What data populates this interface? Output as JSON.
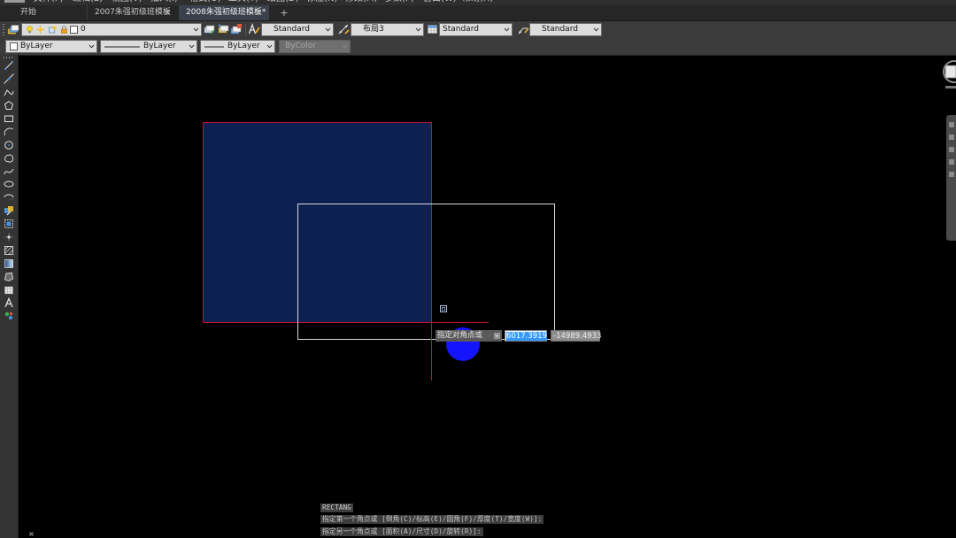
{
  "menu": [
    "文件(F)",
    "编辑(E)",
    "视图(V)",
    "插入(I)",
    "格式(O)",
    "工具(T)",
    "绘图(D)",
    "标注(N)",
    "修改(M)",
    "参数(P)",
    "窗口(W)",
    "帮助(H)"
  ],
  "tabs": {
    "start": "开始",
    "docs": [
      {
        "label": "2007朱强初级班模板",
        "close": "×",
        "active": false
      },
      {
        "label": "2008朱强初级班模板*",
        "close": "×",
        "active": true
      }
    ],
    "add": "+"
  },
  "toolbar_row1": {
    "layer": {
      "name": "0",
      "color": "#ffffff"
    },
    "text_style": "Standard",
    "dim_style": "布局3",
    "table_style": "Standard",
    "mleader_style": "Standard"
  },
  "toolbar_row2": {
    "color": "ByLayer",
    "linetype": "ByLayer",
    "lineweight": "ByLayer",
    "plot_style": "ByColor",
    "plot_style_enabled": false
  },
  "left_toolbar": {
    "tools": [
      "line-icon",
      "construction-line-icon",
      "polyline-icon",
      "polygon-icon",
      "rectangle-icon",
      "arc-icon",
      "circle-icon",
      "revision-cloud-icon",
      "spline-icon",
      "ellipse-icon",
      "ellipse-arc-icon",
      "insert-block-icon",
      "make-block-icon",
      "point-icon",
      "hatch-icon",
      "gradient-icon",
      "region-icon",
      "table-icon",
      "multiline-text-icon",
      "add-selected-icon"
    ]
  },
  "dynamic_input": {
    "prompt": "指定对角点或",
    "x_value": "6017.3919",
    "y_value": "-14989.4933"
  },
  "command_line": {
    "history": [
      "RECTANG",
      "指定第一个角点或 [倒角(C)/标高(E)/圆角(F)/厚度(T)/宽度(W)]:",
      "指定另一个角点或 [面积(A)/尺寸(D)/旋转(R)]:"
    ]
  },
  "colors": {
    "canvas_bg": "#000000",
    "existing_rect_fill": "#0c2152",
    "existing_rect_border": "#c8102e",
    "crosshair": "#c8102e",
    "preview_rect": "#d9d9d9",
    "pickbox": "#a9c2e0",
    "click_indicator": "#1414ff"
  }
}
